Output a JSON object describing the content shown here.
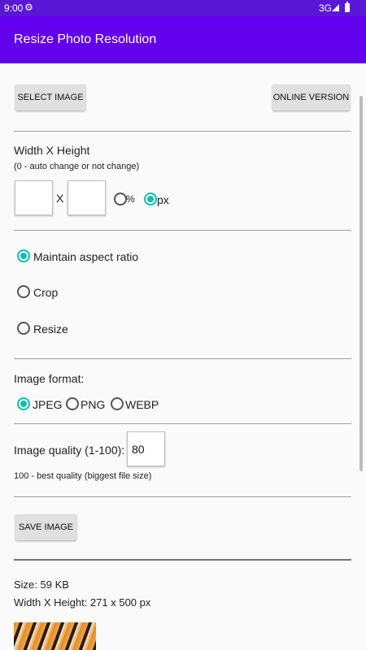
{
  "status_bar": {
    "time": "9:00",
    "network": "3G"
  },
  "app_bar": {
    "title": "Resize Photo Resolution"
  },
  "buttons": {
    "select_image": "SELECT IMAGE",
    "online_version": "ONLINE VERSION",
    "save_image": "SAVE IMAGE"
  },
  "dimensions": {
    "label": "Width X Height",
    "hint": "(0 - auto change or not change)",
    "width_value": "",
    "height_value": "",
    "separator": "X",
    "unit_options": [
      "%",
      "px"
    ],
    "selected_unit": "px"
  },
  "resize_mode": {
    "options": [
      "Maintain aspect ratio",
      "Crop",
      "Resize"
    ],
    "selected": "Maintain aspect ratio"
  },
  "format": {
    "label": "Image format:",
    "options": [
      "JPEG",
      "PNG",
      "WEBP"
    ],
    "selected": "JPEG"
  },
  "quality": {
    "label": "Image quality (1-100):",
    "value": "80",
    "hint": "100 - best quality (biggest file size)"
  },
  "result": {
    "size": "Size: 59 KB",
    "dimensions": "Width X Height: 271 x 500 px"
  },
  "colors": {
    "status_bar": "#5a17d6",
    "app_bar": "#6200ee",
    "accent": "#0fbfae",
    "button": "#e0e0e0"
  }
}
